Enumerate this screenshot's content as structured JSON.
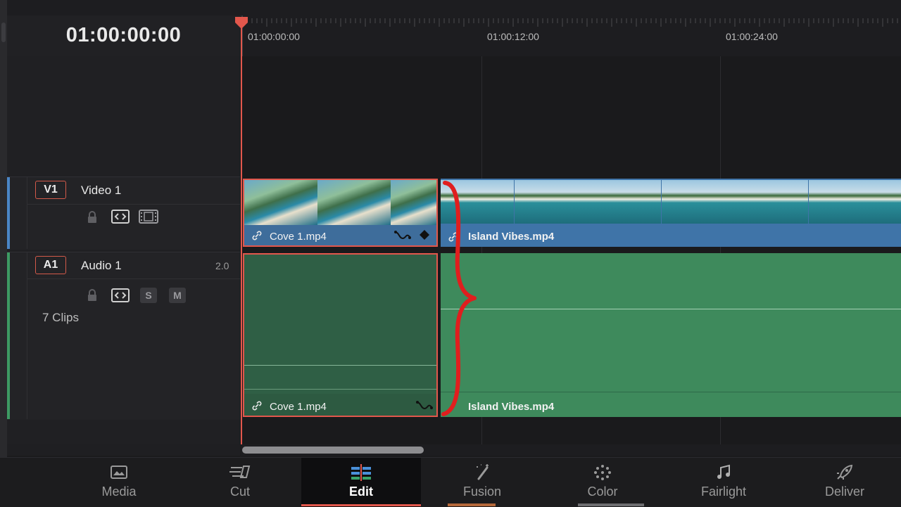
{
  "timeline": {
    "current_timecode": "01:00:00:00",
    "ruler_labels": [
      "01:00:00:00",
      "01:00:12:00",
      "01:00:24:00"
    ]
  },
  "tracks": {
    "video": {
      "badge": "V1",
      "name": "Video 1",
      "color": "#4a86c6"
    },
    "audio": {
      "badge": "A1",
      "name": "Audio 1",
      "channels": "2.0",
      "solo_label": "S",
      "mute_label": "M",
      "clip_count": "7 Clips",
      "color": "#3d9a63"
    }
  },
  "clips": {
    "video": [
      {
        "name": "Cove 1.mp4",
        "selected": true,
        "color": "#3e6d9b"
      },
      {
        "name": "Island Vibes.mp4",
        "selected": false,
        "color": "#3f74a8"
      }
    ],
    "audio": [
      {
        "name": "Cove 1.mp4",
        "selected": true,
        "color": "#2f5f45"
      },
      {
        "name": "Island Vibes.mp4",
        "selected": false,
        "color": "#3e8a5c"
      }
    ]
  },
  "annotation": {
    "color": "#e01e1e"
  },
  "playhead_color": "#e2574c",
  "nav": {
    "active": "Edit",
    "items": [
      {
        "label": "Media",
        "icon": "media-icon"
      },
      {
        "label": "Cut",
        "icon": "cut-icon"
      },
      {
        "label": "Edit",
        "icon": "edit-icon"
      },
      {
        "label": "Fusion",
        "icon": "fusion-icon"
      },
      {
        "label": "Color",
        "icon": "color-icon"
      },
      {
        "label": "Fairlight",
        "icon": "fairlight-icon"
      },
      {
        "label": "Deliver",
        "icon": "deliver-icon"
      }
    ]
  }
}
